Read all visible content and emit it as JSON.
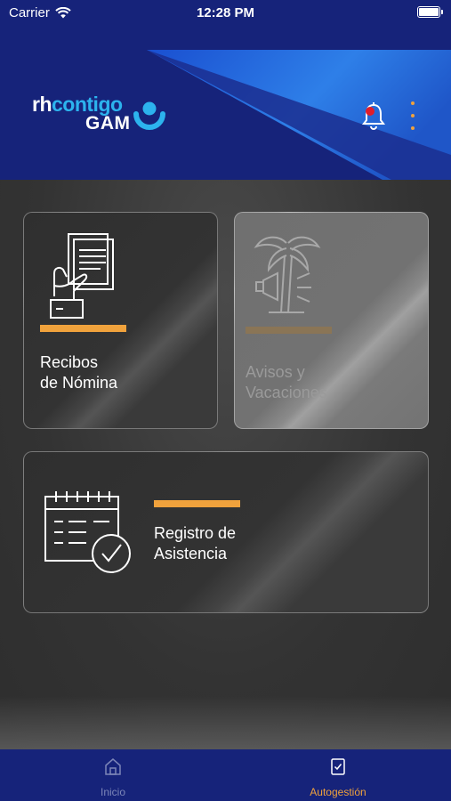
{
  "status_bar": {
    "carrier": "Carrier",
    "time": "12:28 PM"
  },
  "header": {
    "logo_rh": "rh",
    "logo_contigo": "contigo",
    "logo_gam": "GAM",
    "notification_icon": "bell-icon",
    "menu_icon": "more-vertical-icon"
  },
  "cards": [
    {
      "line1": "Recibos",
      "line2": "de Nómina",
      "icon": "payroll-document-hand-icon",
      "enabled": true
    },
    {
      "line1": "Avisos y",
      "line2": "Vacaciones",
      "icon": "palm-tree-megaphone-icon",
      "enabled": false
    },
    {
      "line1": "Registro de",
      "line2": "Asistencia",
      "icon": "calendar-check-icon",
      "enabled": true
    }
  ],
  "tab_bar": {
    "tabs": [
      {
        "label": "Inicio",
        "icon": "home-icon",
        "active": false
      },
      {
        "label": "Autogestión",
        "icon": "clipboard-check-icon",
        "active": true
      }
    ]
  },
  "colors": {
    "brand_navy": "#16237a",
    "brand_blue": "#2cb3ee",
    "accent_orange": "#f0a23c"
  }
}
